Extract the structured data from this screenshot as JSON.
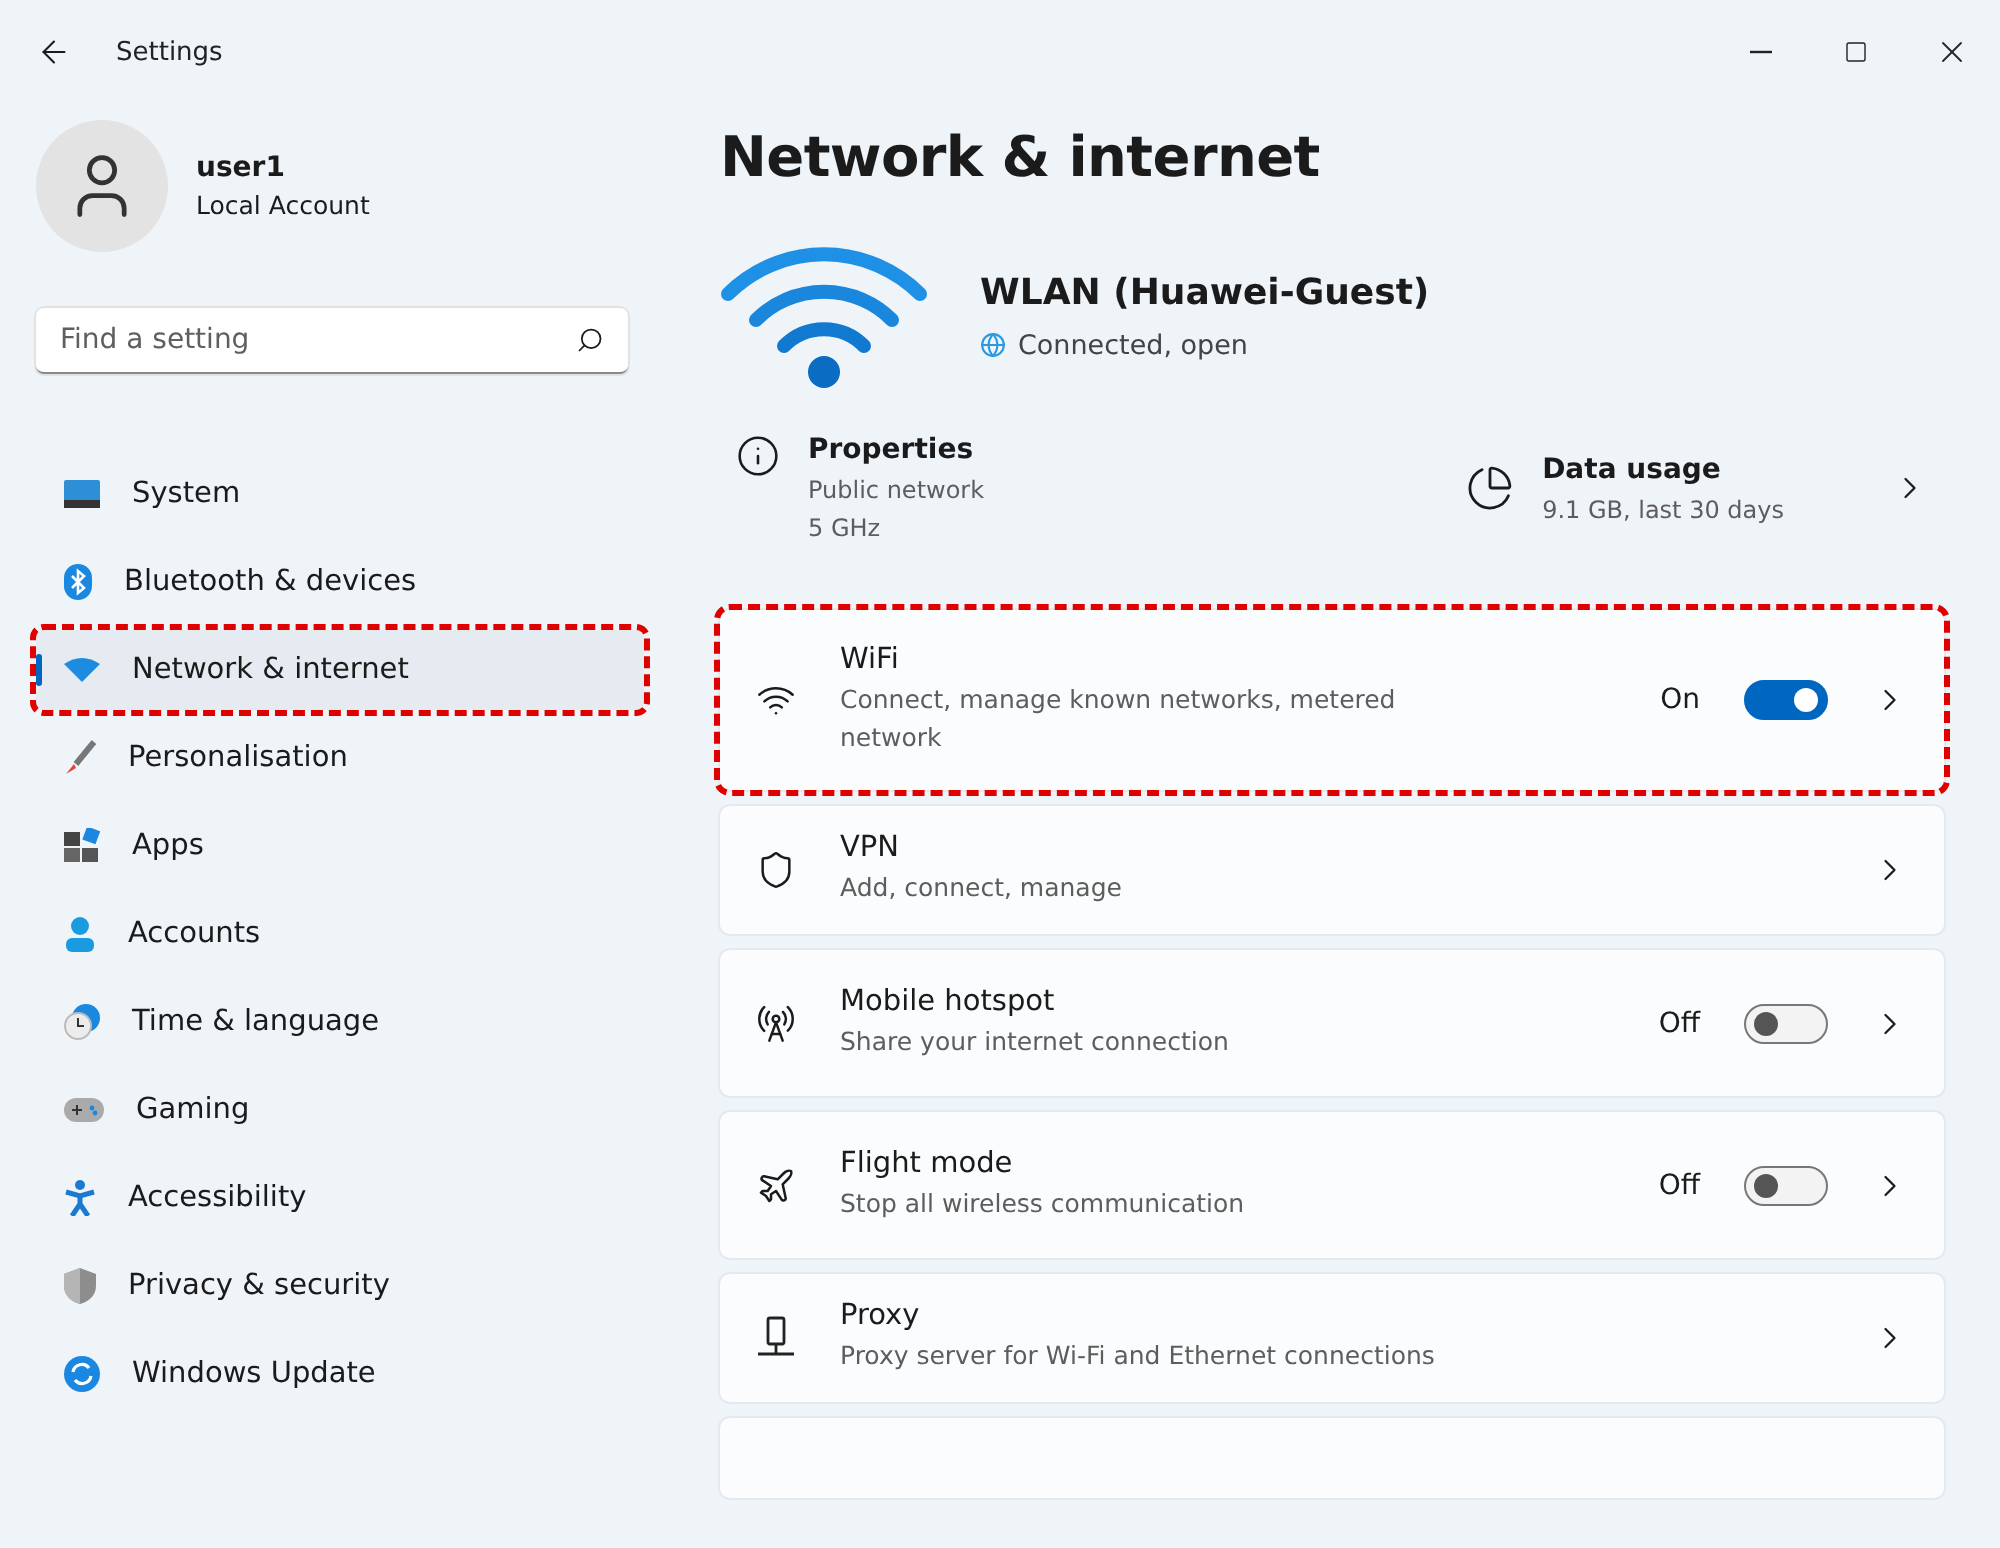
{
  "window": {
    "title": "Settings"
  },
  "account": {
    "name": "user1",
    "type": "Local Account"
  },
  "search": {
    "placeholder": "Find a setting"
  },
  "sidebar": {
    "items": [
      {
        "label": "System",
        "selected": false,
        "highlighted": false
      },
      {
        "label": "Bluetooth & devices",
        "selected": false,
        "highlighted": false
      },
      {
        "label": "Network & internet",
        "selected": true,
        "highlighted": true
      },
      {
        "label": "Personalisation",
        "selected": false,
        "highlighted": false
      },
      {
        "label": "Apps",
        "selected": false,
        "highlighted": false
      },
      {
        "label": "Accounts",
        "selected": false,
        "highlighted": false
      },
      {
        "label": "Time & language",
        "selected": false,
        "highlighted": false
      },
      {
        "label": "Gaming",
        "selected": false,
        "highlighted": false
      },
      {
        "label": "Accessibility",
        "selected": false,
        "highlighted": false
      },
      {
        "label": "Privacy & security",
        "selected": false,
        "highlighted": false
      },
      {
        "label": "Windows Update",
        "selected": false,
        "highlighted": false
      }
    ]
  },
  "page": {
    "title": "Network & internet"
  },
  "connection": {
    "name": "WLAN (Huawei-Guest)",
    "status": "Connected, open"
  },
  "properties": {
    "title": "Properties",
    "lines": [
      "Public network",
      "5 GHz"
    ]
  },
  "data_usage": {
    "title": "Data usage",
    "detail": "9.1 GB, last 30 days"
  },
  "cards": [
    {
      "kind": "toggle",
      "title": "WiFi",
      "subtitle": "Connect, manage known networks, metered network",
      "state_label": "On",
      "on": true,
      "highlighted": true
    },
    {
      "kind": "link",
      "title": "VPN",
      "subtitle": "Add, connect, manage",
      "highlighted": false
    },
    {
      "kind": "toggle",
      "title": "Mobile hotspot",
      "subtitle": "Share your internet connection",
      "state_label": "Off",
      "on": false,
      "highlighted": false
    },
    {
      "kind": "toggle",
      "title": "Flight mode",
      "subtitle": "Stop all wireless communication",
      "state_label": "Off",
      "on": false,
      "highlighted": false
    },
    {
      "kind": "link",
      "title": "Proxy",
      "subtitle": "Proxy server for Wi-Fi and Ethernet connections",
      "highlighted": false
    },
    {
      "kind": "cut"
    }
  ]
}
